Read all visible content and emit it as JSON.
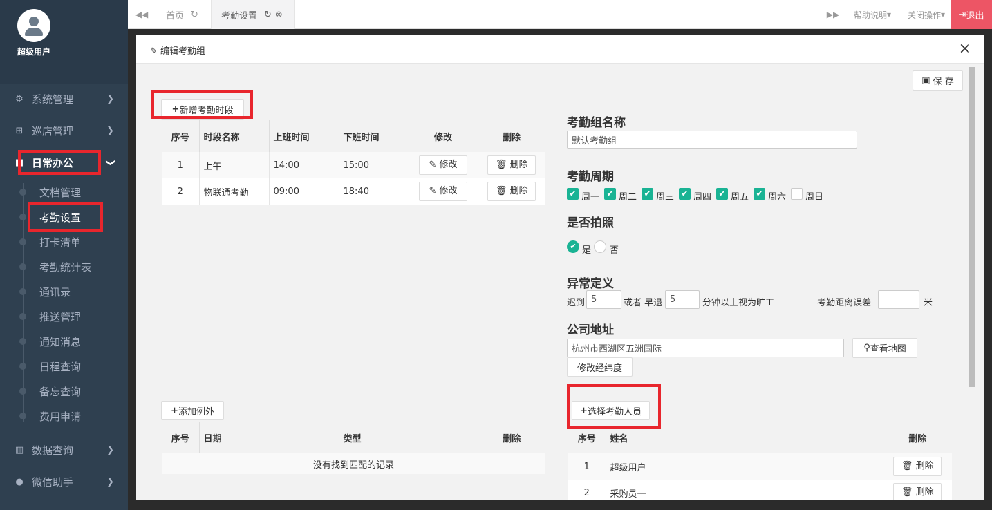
{
  "user": {
    "name": "超级用户"
  },
  "nav": {
    "sys": "系统管理",
    "patrol": "巡店管理",
    "daily": "日常办公",
    "data": "数据查询",
    "wechat": "微信助手",
    "sub": [
      "文档管理",
      "考勤设置",
      "打卡清单",
      "考勤统计表",
      "通讯录",
      "推送管理",
      "通知消息",
      "日程查询",
      "备忘查询",
      "费用申请"
    ]
  },
  "tabs": {
    "home": "首页",
    "current": "考勤设置",
    "help": "帮助说明",
    "close_ops": "关闭操作",
    "exit": "退出"
  },
  "modal": {
    "title": "编辑考勤组",
    "save": "保 存",
    "add_period": "新增考勤时段",
    "period_headers": [
      "序号",
      "时段名称",
      "上班时间",
      "下班时间",
      "修改",
      "删除"
    ],
    "periods": [
      {
        "no": "1",
        "name": "上午",
        "start": "14:00",
        "end": "15:00",
        "edit": "修改",
        "del": "删除"
      },
      {
        "no": "2",
        "name": "物联通考勤",
        "start": "09:00",
        "end": "18:40",
        "edit": "修改",
        "del": "删除"
      }
    ],
    "add_exception": "添加例外",
    "exception_headers": [
      "序号",
      "日期",
      "类型",
      "删除"
    ],
    "exception_empty": "没有找到匹配的记录",
    "group_name_label": "考勤组名称",
    "group_name_value": "默认考勤组",
    "cycle_label": "考勤周期",
    "days": [
      {
        "name": "周一",
        "checked": true
      },
      {
        "name": "周二",
        "checked": true
      },
      {
        "name": "周三",
        "checked": true
      },
      {
        "name": "周四",
        "checked": true
      },
      {
        "name": "周五",
        "checked": true
      },
      {
        "name": "周六",
        "checked": true
      },
      {
        "name": "周日",
        "checked": false
      }
    ],
    "photo_label": "是否拍照",
    "photo_yes": "是",
    "photo_no": "否",
    "abnormal_label": "异常定义",
    "late_prefix": "迟到",
    "late_value": "5",
    "or_early": "或者 早退",
    "early_value": "5",
    "absent_text": "分钟以上视为旷工",
    "distance_label": "考勤距离误差",
    "distance_value": "",
    "distance_unit": "米",
    "address_label": "公司地址",
    "address_value": "杭州市西湖区五洲国际",
    "view_map": "查看地图",
    "edit_coords": "修改经纬度",
    "select_staff": "选择考勤人员",
    "staff_headers": [
      "序号",
      "姓名",
      "删除"
    ],
    "staff": [
      {
        "no": "1",
        "name": "超级用户",
        "del": "删除"
      },
      {
        "no": "2",
        "name": "采购员一",
        "del": "删除"
      }
    ]
  }
}
